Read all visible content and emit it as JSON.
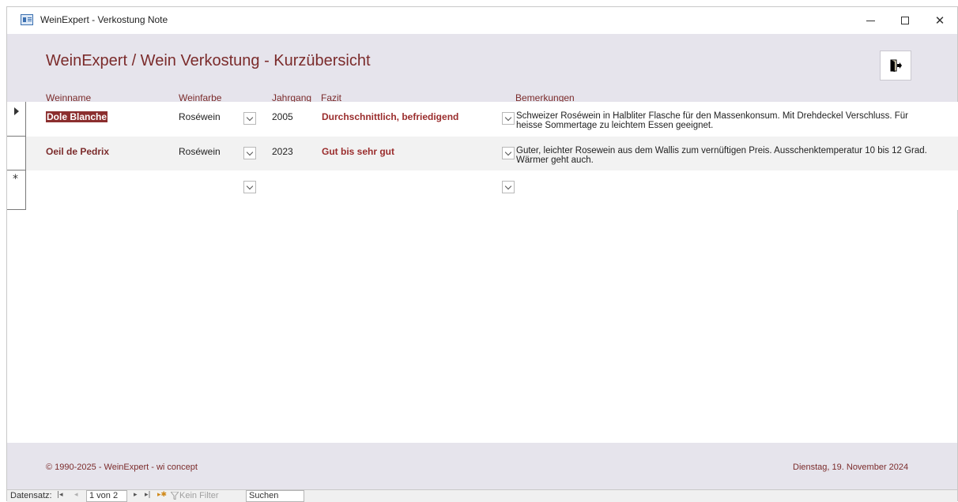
{
  "window": {
    "title": "WeinExpert - Verkostung Note"
  },
  "header": {
    "title": "WeinExpert / Wein Verkostung - Kurzübersicht",
    "columns": {
      "weinname": "Weinname",
      "weinfarbe": "Weinfarbe",
      "jahrgang": "Jahrgang",
      "fazit": "Fazit",
      "bemerkungen": "Bemerkungen"
    }
  },
  "rows": [
    {
      "weinname": "Dole Blanche",
      "weinfarbe": "Roséwein",
      "jahrgang": "2005",
      "fazit": "Durchschnittlich, befriedigend",
      "bemerkungen": "Schweizer Roséwein in Halbliter Flasche für den Massenkonsum. Mit Drehdeckel Verschluss. Für heisse Sommertage zu leichtem Essen geeignet."
    },
    {
      "weinname": "Oeil de Pedrix",
      "weinfarbe": "Roséwein",
      "jahrgang": "2023",
      "fazit": "Gut bis sehr gut",
      "bemerkungen": "Guter, leichter Rosewein aus dem Wallis zum vernüftigen Preis. Ausschenktemperatur 10 bis 12 Grad. Wärmer geht auch."
    }
  ],
  "footer": {
    "copyright": "© 1990-2025 - WeinExpert - wi concept",
    "date": "Dienstag, 19. November 2024"
  },
  "navigation": {
    "label": "Datensatz:",
    "record": "1 von 2",
    "filter": "Kein Filter",
    "search": "Suchen"
  },
  "colors": {
    "accent": "#7b2b2b",
    "band": "#e6e4ec"
  }
}
